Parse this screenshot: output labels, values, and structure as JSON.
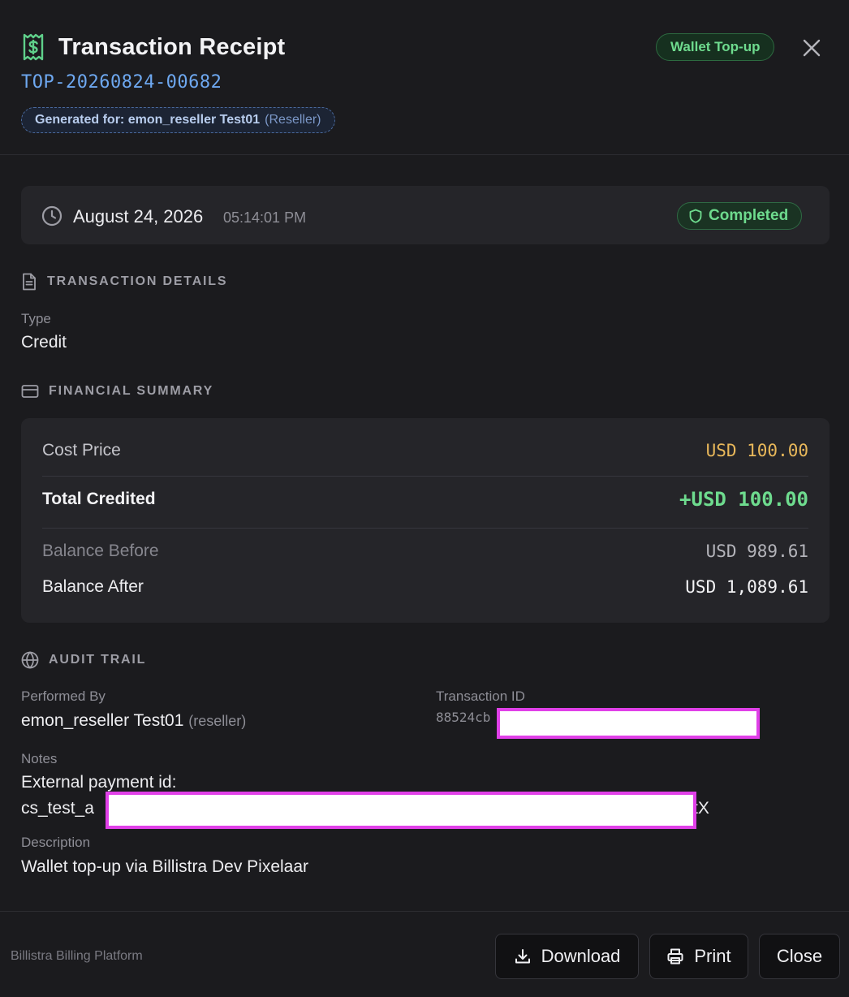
{
  "header": {
    "title": "Transaction Receipt",
    "receipt_number": "TOP-20260824-00682",
    "generated_label": "Generated for: emon_reseller Test01",
    "generated_role": "(Reseller)",
    "type_badge": "Wallet Top-up",
    "icons": {
      "receipt": "receipt-dollar-icon",
      "close": "close-icon"
    },
    "colors": {
      "accent_green": "#6edb8e",
      "link_blue": "#6ea8f0"
    }
  },
  "status": {
    "date": "August 24, 2026",
    "time": "05:14:01 PM",
    "badge": "Completed"
  },
  "transaction_details": {
    "heading": "TRANSACTION DETAILS",
    "type_label": "Type",
    "type_value": "Credit"
  },
  "financial_summary": {
    "heading": "FINANCIAL SUMMARY",
    "cost_price_label": "Cost Price",
    "cost_price_value": "USD 100.00",
    "total_credited_label": "Total Credited",
    "total_credited_value": "+USD 100.00",
    "balance_before_label": "Balance Before",
    "balance_before_value": "USD 989.61",
    "balance_after_label": "Balance After",
    "balance_after_value": "USD 1,089.61",
    "colors": {
      "cost": "#e9b85a",
      "credited": "#6edb8e"
    }
  },
  "audit_trail": {
    "heading": "AUDIT TRAIL",
    "performed_by_label": "Performed By",
    "performed_by_value": "emon_reseller Test01",
    "performed_by_role": "(reseller)",
    "transaction_id_label": "Transaction ID",
    "transaction_id_prefix": "88524cb",
    "notes_label": "Notes",
    "notes_line1": "External payment id:",
    "notes_line2_prefix": "cs_test_a",
    "notes_line2_suffix": "tX",
    "description_label": "Description",
    "description_value": "Wallet top-up via Billistra Dev Pixelaar"
  },
  "footer": {
    "brand": "Billistra Billing Platform",
    "download_label": "Download",
    "print_label": "Print",
    "close_label": "Close"
  }
}
